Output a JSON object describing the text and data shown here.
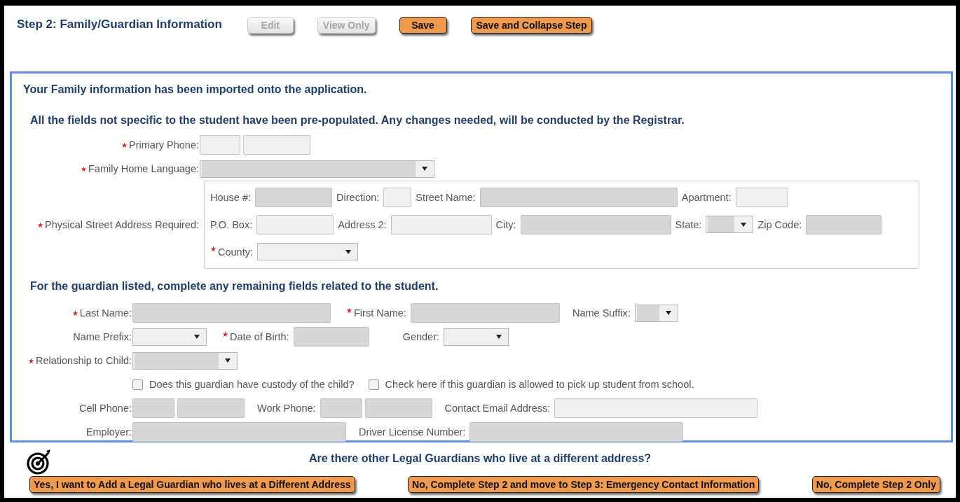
{
  "header": {
    "title": "Step 2: Family/Guardian Information",
    "buttons": [
      {
        "label": "Edit",
        "disabled": true
      },
      {
        "label": "View Only",
        "disabled": true
      },
      {
        "label": "Save",
        "disabled": false
      },
      {
        "label": "Save and Collapse Step",
        "disabled": false
      }
    ]
  },
  "panel": {
    "notice": "Your Family information has been imported onto the application.",
    "instructions": "All the fields not specific to the student have been pre-populated. Any changes needed, will be conducted by the Registrar.",
    "family_rows": [
      {
        "label": "Primary Phone:",
        "required": true,
        "controls": [
          {
            "kind": "phone",
            "prefilled": false
          }
        ]
      },
      {
        "label": "Family Home Language:",
        "required": true,
        "controls": [
          {
            "kind": "select",
            "prefilled": true
          }
        ]
      },
      {
        "label": "Physical Street Address Required:",
        "required": true,
        "lines": [
          [
            {
              "kind": "text",
              "label": "House #:",
              "required": false,
              "prefilled": true
            },
            {
              "kind": "text",
              "label": "Direction:",
              "required": false,
              "prefilled": false
            },
            {
              "kind": "text",
              "label": "Street Name:",
              "required": false,
              "prefilled": true
            },
            {
              "kind": "text",
              "label": "Apartment:",
              "required": false,
              "prefilled": false
            }
          ],
          [
            {
              "kind": "text",
              "label": "P.O. Box:",
              "required": false,
              "prefilled": false
            },
            {
              "kind": "text",
              "label": "Address 2:",
              "required": false,
              "prefilled": false
            },
            {
              "kind": "text",
              "label": "City:",
              "required": false,
              "prefilled": true
            },
            {
              "kind": "select",
              "label": "State:",
              "required": false,
              "prefilled": true
            },
            {
              "kind": "text",
              "label": "Zip Code:",
              "required": false,
              "prefilled": true
            }
          ],
          [
            {
              "kind": "select",
              "label": "County:",
              "required": true,
              "prefilled": false
            }
          ]
        ]
      }
    ],
    "guardian_heading": "For the guardian listed, complete any remaining fields related to the student.",
    "guardian_rows": [
      {
        "label": "Last Name:",
        "required": true,
        "controls": [
          {
            "kind": "text",
            "prefilled": true
          },
          {
            "kind": "text",
            "label": "First Name:",
            "required": true,
            "prefilled": true
          },
          {
            "kind": "select",
            "label": "Name Suffix:",
            "required": false,
            "prefilled": true
          }
        ]
      },
      {
        "label": "Name Prefix:",
        "required": false,
        "controls": [
          {
            "kind": "select",
            "prefilled": false
          },
          {
            "kind": "text",
            "label": "Date of Birth:",
            "required": true,
            "prefilled": true
          },
          {
            "kind": "select",
            "label": "Gender:",
            "required": false,
            "prefilled": false
          }
        ]
      },
      {
        "label": "Relationship to Child:",
        "required": true,
        "controls": [
          {
            "kind": "select",
            "prefilled": true
          }
        ]
      },
      {
        "controls": [
          {
            "kind": "checkbox",
            "label": "Does this guardian have custody of the child?",
            "checked": false
          },
          {
            "kind": "checkbox",
            "label": "Check here if this guardian is allowed to pick up student from school.",
            "checked": false
          }
        ]
      },
      {
        "label": "Cell Phone:",
        "required": false,
        "controls": [
          {
            "kind": "phone",
            "prefilled": true
          },
          {
            "kind": "phone",
            "label": "Work Phone:",
            "required": false,
            "prefilled": true
          },
          {
            "kind": "text",
            "label": "Contact Email Address:",
            "required": false,
            "prefilled": false
          }
        ]
      },
      {
        "label": "Employer:",
        "required": false,
        "controls": [
          {
            "kind": "text",
            "prefilled": true
          },
          {
            "kind": "text",
            "label": "Driver License Number:",
            "required": false,
            "prefilled": true
          }
        ]
      }
    ]
  },
  "footer": {
    "question": "Are there other Legal Guardians who live at a different address?",
    "buttons": [
      {
        "label": "Yes, I want to Add a Legal Guardian who lives at a Different Address"
      },
      {
        "label": "No, Complete Step 2 and move to Step 3: Emergency Contact Information"
      },
      {
        "label": "No, Complete Step 2 Only"
      }
    ]
  }
}
